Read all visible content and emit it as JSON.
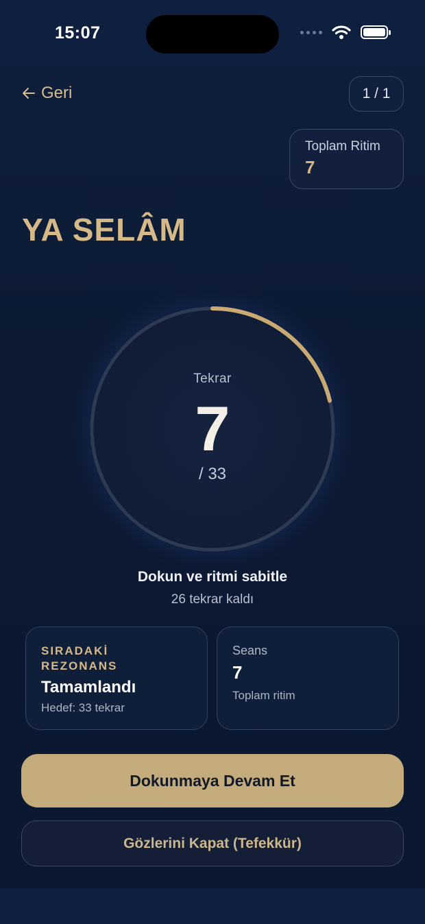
{
  "status_bar": {
    "time": "15:07",
    "icons": [
      "signal-dots-icon",
      "wifi-icon",
      "battery-icon"
    ]
  },
  "nav": {
    "back_label": "Geri",
    "back_icon": "arrow-left-icon",
    "page_indicator": "1 / 1"
  },
  "total_rhythm": {
    "label": "Toplam Ritim",
    "value": "7"
  },
  "title": "YA SELÂM",
  "counter": {
    "label": "Tekrar",
    "count": "7",
    "target_text": "/ 33",
    "progress_fraction": 0.212
  },
  "instruction": "Dokun ve ritmi sabitle",
  "remaining": "26 tekrar kaldı",
  "cards": {
    "next": {
      "eyebrow_line1": "SIRADAKİ",
      "eyebrow_line2": "REZONANS",
      "status": "Tamamlandı",
      "target": "Hedef: 33 tekrar"
    },
    "session": {
      "label": "Seans",
      "value": "7",
      "caption": "Toplam ritim"
    }
  },
  "buttons": {
    "primary": "Dokunmaya Devam Et",
    "secondary": "Gözlerini Kapat (Tefekkür)"
  },
  "colors": {
    "accent_gold": "#d6b988",
    "button_gold": "#c4ab7c",
    "background": "#0c1a33"
  }
}
